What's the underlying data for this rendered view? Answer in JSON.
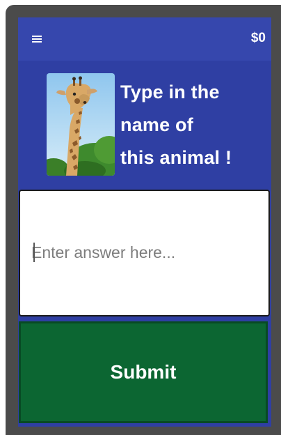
{
  "app_bar": {
    "menu_icon": "hamburger-menu-icon",
    "balance": "$0",
    "color": "#3647ad"
  },
  "question": {
    "image": "giraffe",
    "prompt_lines": [
      "Type in the",
      "name of",
      "this animal !"
    ],
    "color": "#2f3fa3"
  },
  "answer": {
    "value": "",
    "placeholder": "Enter answer here..."
  },
  "submit": {
    "label": "Submit",
    "color": "#0c6632"
  }
}
